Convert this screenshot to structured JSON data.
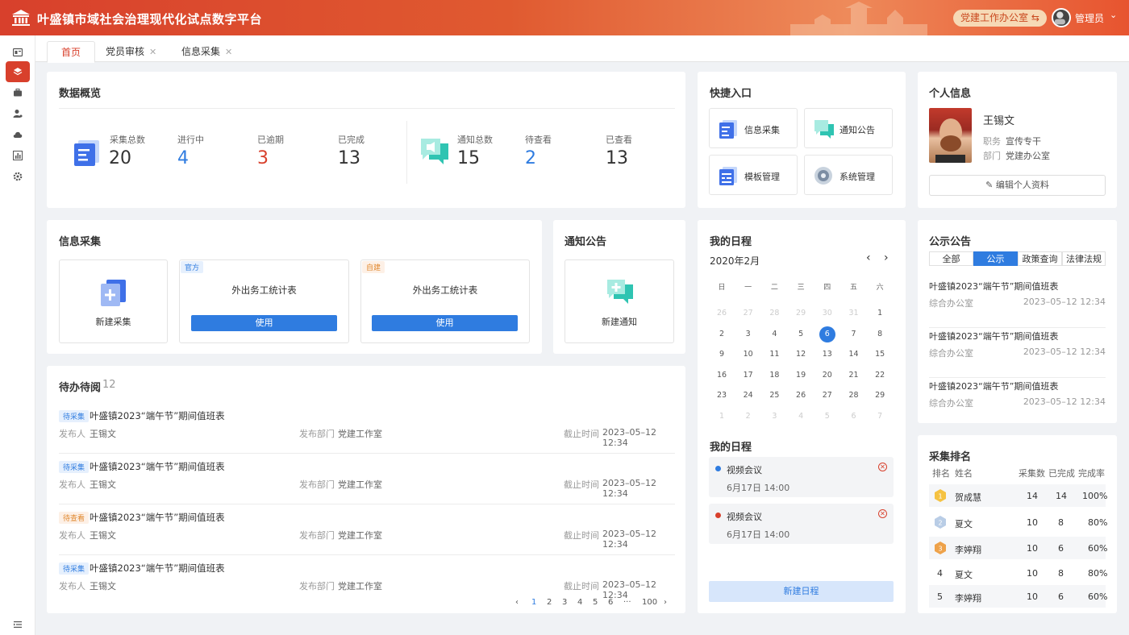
{
  "header": {
    "title": "叶盛镇市域社会治理现代化试点数字平台",
    "office_switch": "党建工作办公室 ⇆",
    "username": "管理员",
    "user_chevron": "⌄"
  },
  "sidebar": {
    "items": [
      {
        "icon": "dashboard-icon"
      },
      {
        "icon": "layers-icon",
        "active": true
      },
      {
        "icon": "briefcase-icon"
      },
      {
        "icon": "user-settings-icon"
      },
      {
        "icon": "cloud-icon"
      },
      {
        "icon": "bar-chart-icon"
      },
      {
        "icon": "gear-icon"
      }
    ],
    "collapse_icon": "menu-collapse-icon"
  },
  "tabs": [
    {
      "label": "首页",
      "active": true
    },
    {
      "label": "党员审核",
      "closable": true
    },
    {
      "label": "信息采集",
      "closable": true
    }
  ],
  "overview": {
    "title": "数据概览",
    "collect": {
      "total_label": "采集总数",
      "total": "20",
      "ongoing_label": "进行中",
      "ongoing": "4",
      "overdue_label": "已逾期",
      "overdue": "3",
      "done_label": "已完成",
      "done": "13"
    },
    "notice": {
      "total_label": "通知总数",
      "total": "15",
      "unread_label": "待查看",
      "unread": "2",
      "read_label": "已查看",
      "read": "13"
    }
  },
  "quick_entry": {
    "title": "快捷入口",
    "items": [
      {
        "label": "信息采集",
        "icon": "form-icon"
      },
      {
        "label": "通知公告",
        "icon": "message-icon"
      },
      {
        "label": "模板管理",
        "icon": "template-icon"
      },
      {
        "label": "系统管理",
        "icon": "settings-gear-icon"
      }
    ]
  },
  "profile": {
    "title": "个人信息",
    "name": "王锡文",
    "position_label": "职务",
    "position": "宣传专干",
    "dept_label": "部门",
    "dept": "党建办公室",
    "edit_label": "编辑个人资料"
  },
  "info_collect": {
    "title": "信息采集",
    "new_label": "新建采集",
    "templates": [
      {
        "tag": "官方",
        "name": "外出务工统计表",
        "button": "使用"
      },
      {
        "tag": "自建",
        "name": "外出务工统计表",
        "button": "使用"
      }
    ]
  },
  "notice_box": {
    "title": "通知公告",
    "new_label": "新建通知"
  },
  "calendar": {
    "title": "我的日程",
    "month": "2020年2月",
    "prev": "‹",
    "next": "›",
    "weekdays": [
      "日",
      "一",
      "二",
      "三",
      "四",
      "五",
      "六"
    ],
    "rows": [
      [
        "26",
        "27",
        "28",
        "29",
        "30",
        "31",
        "1"
      ],
      [
        "2",
        "3",
        "4",
        "5",
        "6",
        "7",
        "8"
      ],
      [
        "9",
        "10",
        "11",
        "12",
        "13",
        "14",
        "15"
      ],
      [
        "16",
        "17",
        "18",
        "19",
        "20",
        "21",
        "22"
      ],
      [
        "23",
        "24",
        "25",
        "26",
        "27",
        "28",
        "29"
      ],
      [
        "1",
        "2",
        "3",
        "4",
        "5",
        "6",
        "7"
      ]
    ],
    "today": "6"
  },
  "schedule": {
    "title": "我的日程",
    "items": [
      {
        "title": "视频会议",
        "time": "6月17日 14:00",
        "color": "#2f7ce0"
      },
      {
        "title": "视频会议",
        "time": "6月17日 14:00",
        "color": "#d8402c"
      }
    ],
    "new_label": "新建日程"
  },
  "todo": {
    "title": "待办待阅",
    "count": "12",
    "publisher_label": "发布人",
    "dept_label": "发布部门",
    "deadline_label": "截止时间",
    "items": [
      {
        "tag": "待采集",
        "tag_type": "blue",
        "title": "叶盛镇2023“端午节”期间值班表",
        "publisher": "王锡文",
        "dept": "党建工作室",
        "deadline": "2023–05–12 12:34"
      },
      {
        "tag": "待采集",
        "tag_type": "blue",
        "title": "叶盛镇2023“端午节”期间值班表",
        "publisher": "王锡文",
        "dept": "党建工作室",
        "deadline": "2023–05–12 12:34"
      },
      {
        "tag": "待查看",
        "tag_type": "orange",
        "title": "叶盛镇2023“端午节”期间值班表",
        "publisher": "王锡文",
        "dept": "党建工作室",
        "deadline": "2023–05–12 12:34"
      },
      {
        "tag": "待采集",
        "tag_type": "blue",
        "title": "叶盛镇2023“端午节”期间值班表",
        "publisher": "王锡文",
        "dept": "党建工作室",
        "deadline": "2023–05–12 12:34"
      }
    ],
    "pager": {
      "prev": "‹",
      "pages": [
        "1",
        "2",
        "3",
        "4",
        "5",
        "6",
        "···",
        "100"
      ],
      "current": "1",
      "next": "›"
    }
  },
  "public_notice": {
    "title": "公示公告",
    "tabs": [
      {
        "label": "全部"
      },
      {
        "label": "公示",
        "active": true
      },
      {
        "label": "政策查询"
      },
      {
        "label": "法律法规"
      }
    ],
    "items": [
      {
        "title": "叶盛镇2023“端午节”期间值班表",
        "dept": "综合办公室",
        "time": "2023–05–12 12:34"
      },
      {
        "title": "叶盛镇2023“端午节”期间值班表",
        "dept": "综合办公室",
        "time": "2023–05–12 12:34"
      },
      {
        "title": "叶盛镇2023“端午节”期间值班表",
        "dept": "综合办公室",
        "time": "2023–05–12 12:34"
      }
    ]
  },
  "ranking": {
    "title": "采集排名",
    "headers": [
      "排名",
      "姓名",
      "采集数",
      "已完成",
      "完成率"
    ],
    "rows": [
      {
        "rank": "1",
        "medal": "gold",
        "name": "贺成慧",
        "count": "14",
        "done": "14",
        "rate": "100%"
      },
      {
        "rank": "2",
        "medal": "silver",
        "name": "夏文",
        "count": "10",
        "done": "8",
        "rate": "80%"
      },
      {
        "rank": "3",
        "medal": "bronze",
        "name": "李婷翔",
        "count": "10",
        "done": "6",
        "rate": "60%"
      },
      {
        "rank": "4",
        "name": "夏文",
        "count": "10",
        "done": "8",
        "rate": "80%"
      },
      {
        "rank": "5",
        "name": "李婷翔",
        "count": "10",
        "done": "6",
        "rate": "60%"
      }
    ]
  }
}
